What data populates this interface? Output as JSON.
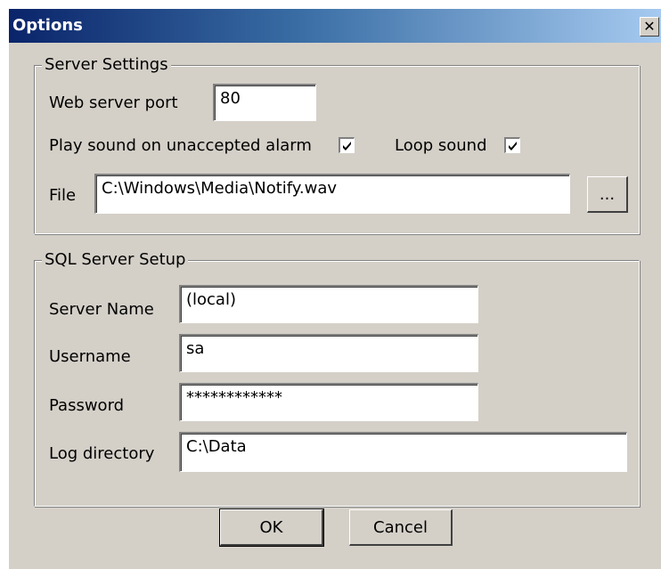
{
  "window": {
    "title": "Options",
    "close_glyph": "✕"
  },
  "server_settings": {
    "legend": "Server Settings",
    "port_label": "Web server port",
    "port_value": "80",
    "play_sound_label": "Play sound on unaccepted alarm",
    "play_sound_checked": true,
    "loop_sound_label": "Loop sound",
    "loop_sound_checked": true,
    "file_label": "File",
    "file_value": "C:\\Windows\\Media\\Notify.wav",
    "browse_label": "..."
  },
  "sql_setup": {
    "legend": "SQL Server Setup",
    "server_name_label": "Server Name",
    "server_name_value": "(local)",
    "username_label": "Username",
    "username_value": "sa",
    "password_label": "Password",
    "password_value": "************",
    "log_dir_label": "Log directory",
    "log_dir_value": "C:\\Data"
  },
  "buttons": {
    "ok_label": "OK",
    "cancel_label": "Cancel"
  },
  "colors": {
    "dialog_bg": "#d4d0c8",
    "titlebar_start": "#0a246a",
    "titlebar_end": "#a6caf0"
  }
}
